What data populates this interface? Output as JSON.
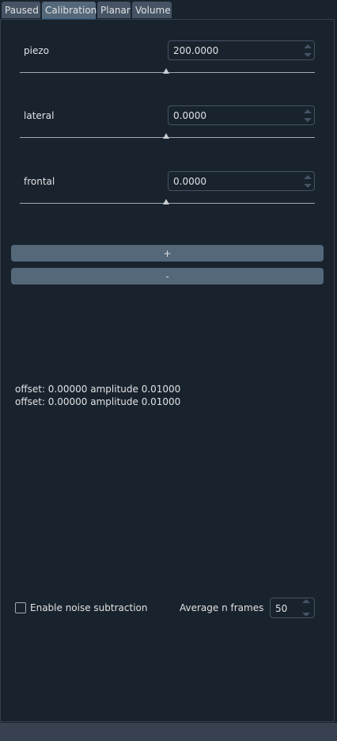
{
  "tabs": [
    {
      "label": "Paused"
    },
    {
      "label": "Calibration"
    },
    {
      "label": "Planar"
    },
    {
      "label": "Volume"
    }
  ],
  "active_tab": "Calibration",
  "controls": {
    "piezo": {
      "label": "piezo",
      "value": "200.0000",
      "slider_fraction": 0.5
    },
    "lateral": {
      "label": "lateral",
      "value": "0.0000",
      "slider_fraction": 0.5
    },
    "frontal": {
      "label": "frontal",
      "value": "0.0000",
      "slider_fraction": 0.5
    }
  },
  "buttons": {
    "add_label": "+",
    "remove_label": "-"
  },
  "info_lines": [
    "offset: 0.00000 amplitude 0.01000",
    "offset: 0.00000 amplitude 0.01000"
  ],
  "noise": {
    "checkbox_label": "Enable noise subtraction",
    "checked": false,
    "avg_label": "Average n frames",
    "avg_value": "50"
  },
  "colors": {
    "background": "#19232d",
    "tab": "#455364",
    "button": "#54687a",
    "text": "#e0e1e3"
  }
}
